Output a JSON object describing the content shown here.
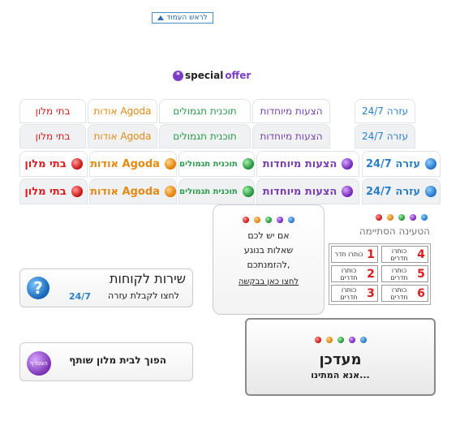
{
  "top_link": {
    "label": "לראש העמוד"
  },
  "special_offer": {
    "word1": "special",
    "word2": "offer",
    "star": "*"
  },
  "tabs": [
    {
      "label": "עזרה 24/7",
      "color": "blue"
    },
    {
      "label": "הצעות מיוחדות",
      "color": "purple"
    },
    {
      "label": "תוכנית תגמולים",
      "color": "green"
    },
    {
      "label": "אודות Agoda",
      "color": "orange"
    },
    {
      "label": "בתי מלון",
      "color": "red"
    }
  ],
  "popup": {
    "lines": [
      "אם יש לכם",
      "שאלות בנוגע",
      "להזמנתכם,"
    ],
    "link": "לחצו כאן בבקשה"
  },
  "loading": {
    "text": "הטעינה הסתיימה"
  },
  "rooms": [
    {
      "num": "4",
      "label": "כותרו חדרים"
    },
    {
      "num": "1",
      "label": "כותרו חדר"
    },
    {
      "num": "5",
      "label": "כותרו חדרים"
    },
    {
      "num": "2",
      "label": "כותרו חדרים"
    },
    {
      "num": "6",
      "label": "כותרו חדרים"
    },
    {
      "num": "3",
      "label": "כותרו חדרים"
    }
  ],
  "loader": {
    "title": "מעדכן",
    "subtitle": "אנא המתינו..."
  },
  "service": {
    "title": "שירות לקוחות",
    "subtitle": "לחצו לקבלת עזרה",
    "badge": "24/7",
    "icon": "?"
  },
  "partner": {
    "label": "הפוך לבית מלון שותף",
    "button": "הצטרף"
  },
  "colors": {
    "blue": "#2a7fc9",
    "purple": "#7a3fb0",
    "green": "#2a9a4a",
    "orange": "#e28a12",
    "red": "#d81e1e"
  }
}
